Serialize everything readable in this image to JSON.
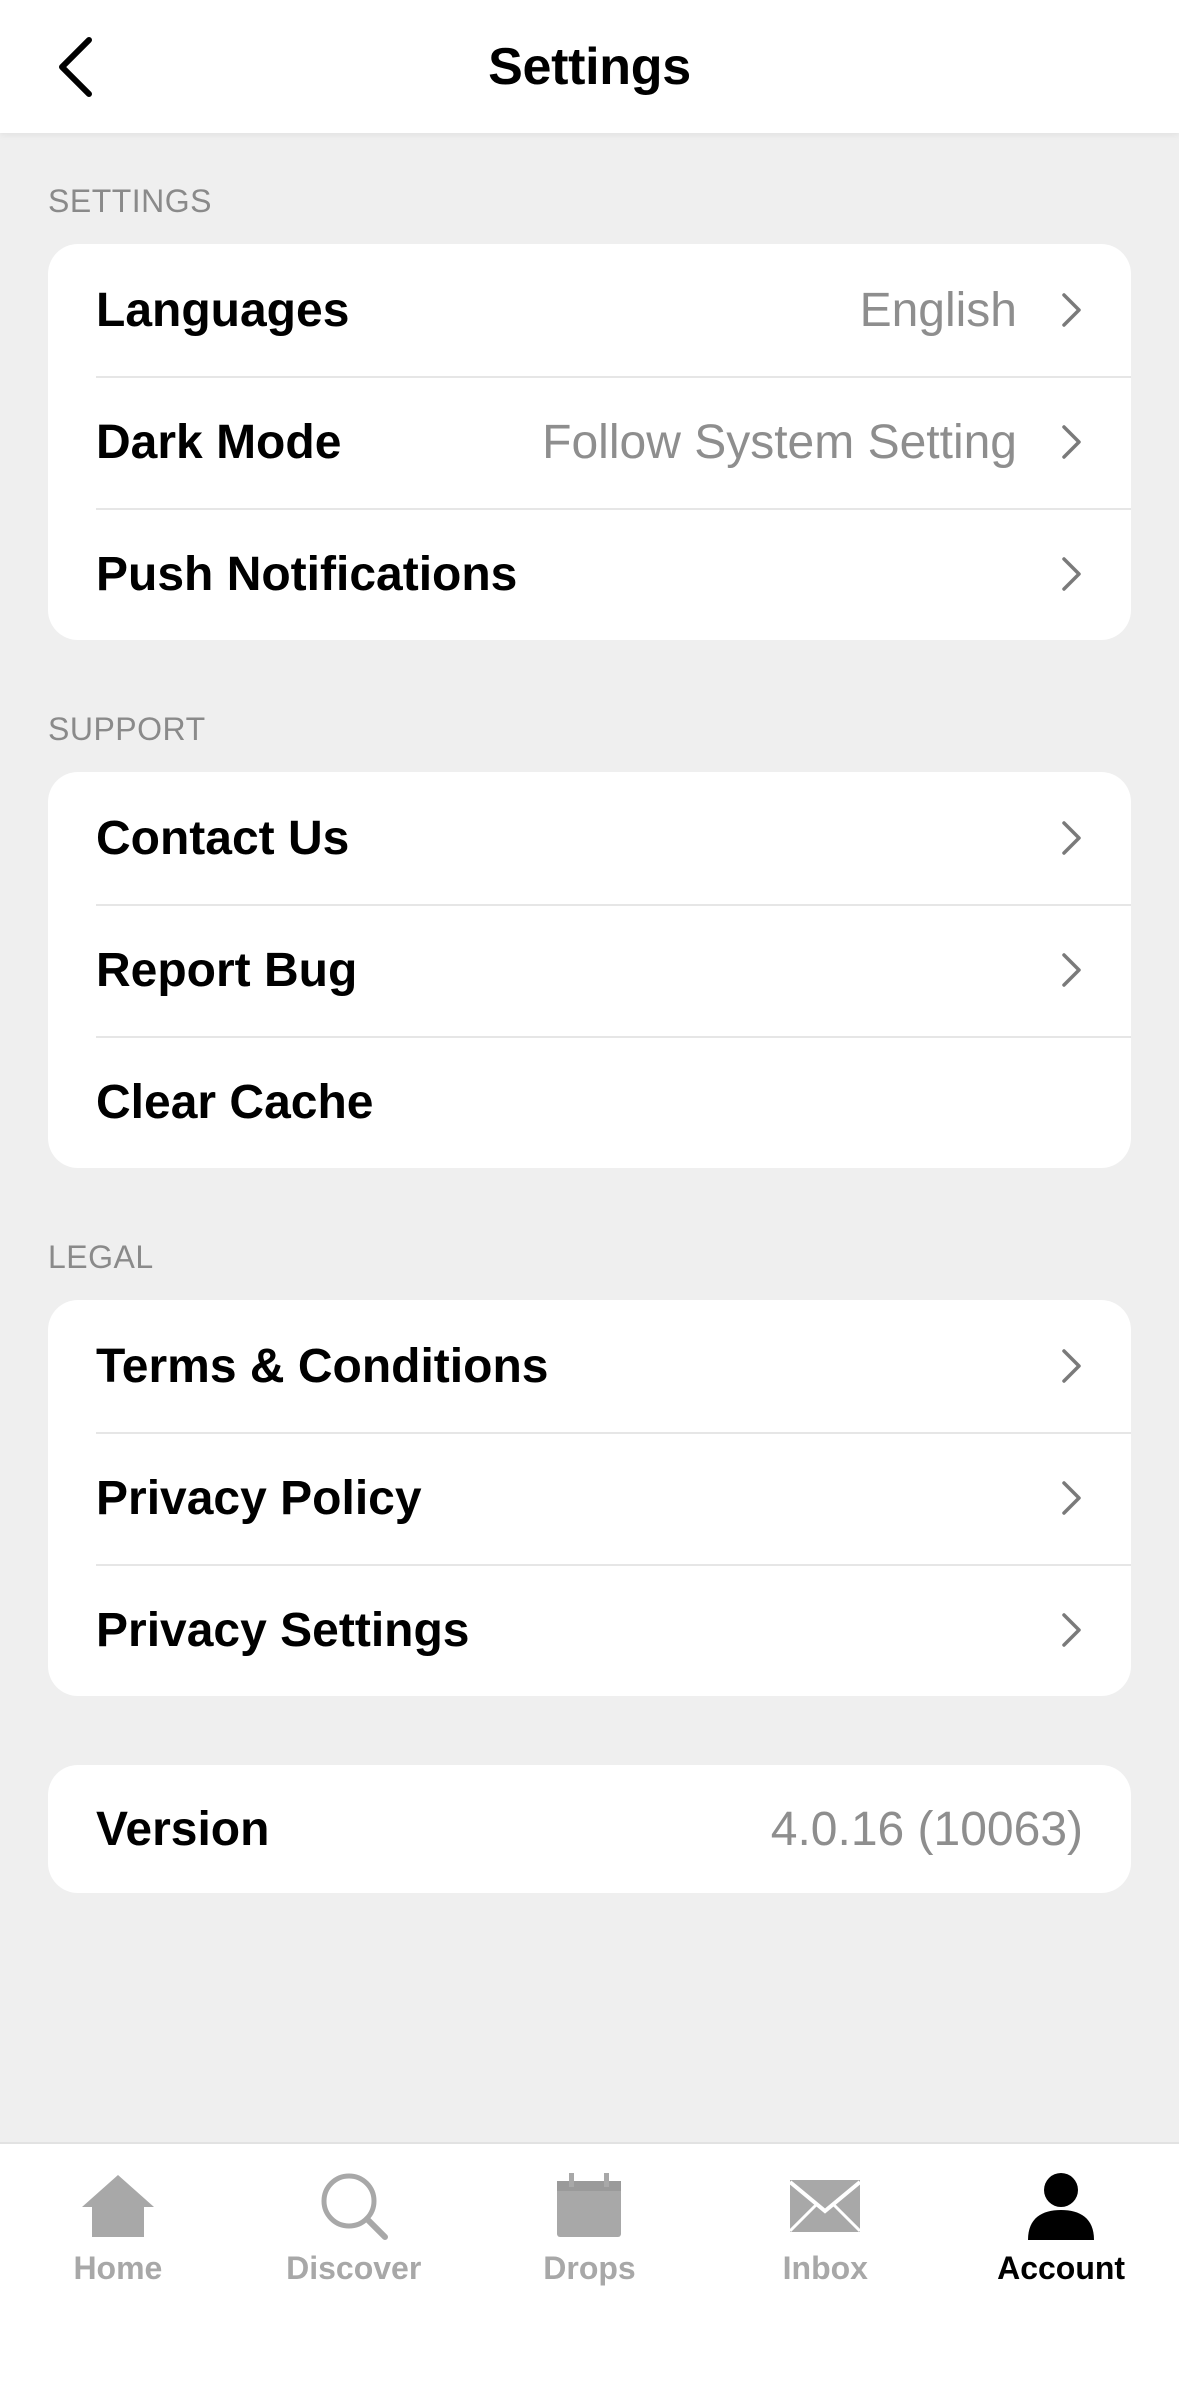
{
  "header": {
    "title": "Settings"
  },
  "sections": {
    "settings": {
      "label": "SETTINGS",
      "rows": [
        {
          "label": "Languages",
          "value": "English"
        },
        {
          "label": "Dark Mode",
          "value": "Follow System Setting"
        },
        {
          "label": "Push Notifications"
        }
      ]
    },
    "support": {
      "label": "SUPPORT",
      "rows": [
        {
          "label": "Contact Us"
        },
        {
          "label": "Report Bug"
        },
        {
          "label": "Clear Cache"
        }
      ]
    },
    "legal": {
      "label": "LEGAL",
      "rows": [
        {
          "label": "Terms & Conditions"
        },
        {
          "label": "Privacy Policy"
        },
        {
          "label": "Privacy Settings"
        }
      ]
    },
    "version": {
      "label": "Version",
      "value": "4.0.16 (10063)"
    }
  },
  "tabbar": {
    "items": [
      {
        "label": "Home",
        "icon": "home-icon"
      },
      {
        "label": "Discover",
        "icon": "search-icon"
      },
      {
        "label": "Drops",
        "icon": "calendar-icon"
      },
      {
        "label": "Inbox",
        "icon": "mail-icon"
      },
      {
        "label": "Account",
        "icon": "person-icon"
      }
    ],
    "active": "Account"
  },
  "colors": {
    "background": "#efefef",
    "card": "#ffffff",
    "secondary_text": "#8e8e8e",
    "inactive_tab": "#a8a8a8",
    "active_tab": "#000000"
  }
}
